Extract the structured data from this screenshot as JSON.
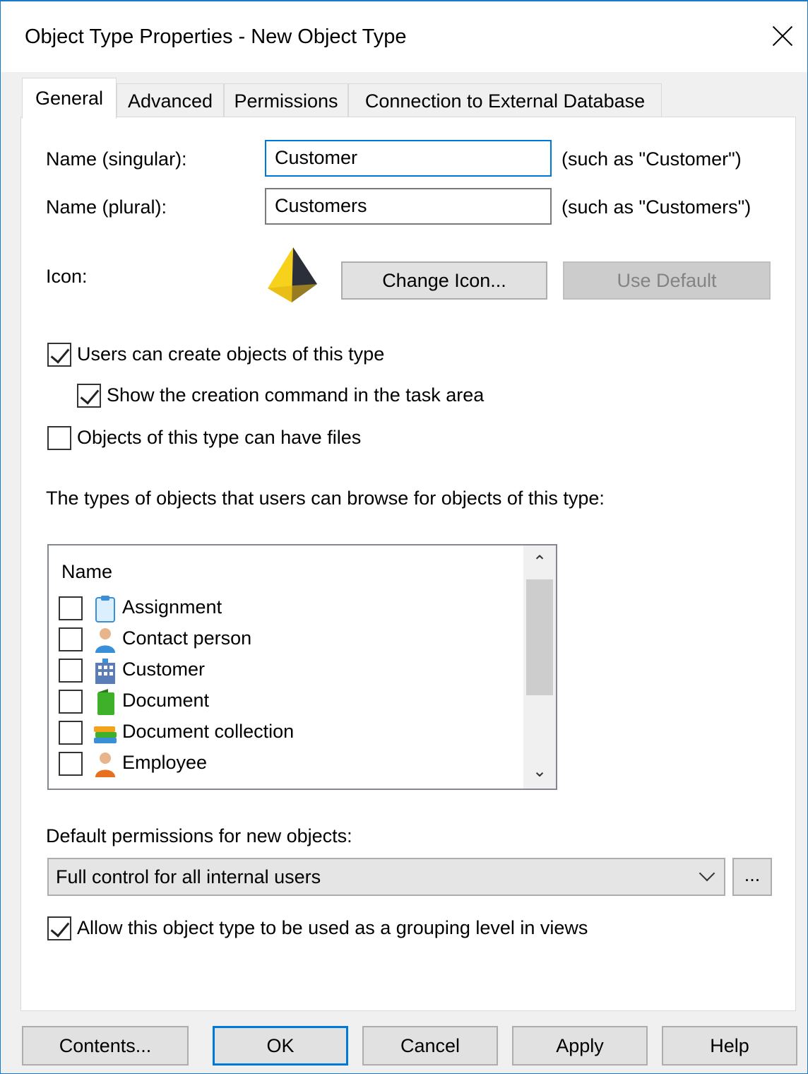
{
  "window": {
    "title": "Object Type Properties - New Object Type"
  },
  "tabs": [
    {
      "label": "General"
    },
    {
      "label": "Advanced"
    },
    {
      "label": "Permissions"
    },
    {
      "label": "Connection to External Database"
    }
  ],
  "general": {
    "name_singular": {
      "label": "Name (singular):",
      "value": "Customer",
      "hint": "(such as \"Customer\")"
    },
    "name_plural": {
      "label": "Name (plural):",
      "value": "Customers",
      "hint": "(such as \"Customers\")"
    },
    "icon": {
      "label": "Icon:",
      "icon_name": "pyramid-icon",
      "change_label": "Change Icon...",
      "default_label": "Use Default"
    },
    "users_can_create": {
      "label": "Users can create objects of this type",
      "checked": true
    },
    "show_creation": {
      "label": "Show the creation command in the task area",
      "checked": true
    },
    "can_have_files": {
      "label": "Objects of this type can have files",
      "checked": false
    },
    "browse_label": "The types of objects that users can browse for objects of this type:",
    "browse_list": {
      "header": "Name",
      "items": [
        {
          "label": "Assignment",
          "icon": "clipboard-icon",
          "checked": false
        },
        {
          "label": "Contact person",
          "icon": "contact-person-icon",
          "checked": false
        },
        {
          "label": "Customer",
          "icon": "building-icon",
          "checked": false
        },
        {
          "label": "Document",
          "icon": "document-icon",
          "checked": false
        },
        {
          "label": "Document collection",
          "icon": "document-collection-icon",
          "checked": false
        },
        {
          "label": "Employee",
          "icon": "employee-icon",
          "checked": false
        }
      ]
    },
    "default_permissions": {
      "label": "Default permissions for new objects:",
      "value": "Full control for all internal users",
      "more_label": "..."
    },
    "grouping_level": {
      "label": "Allow this object type to be used as a grouping level in views",
      "checked": true
    }
  },
  "buttons": {
    "contents": "Contents...",
    "ok": "OK",
    "cancel": "Cancel",
    "apply": "Apply",
    "help": "Help"
  }
}
